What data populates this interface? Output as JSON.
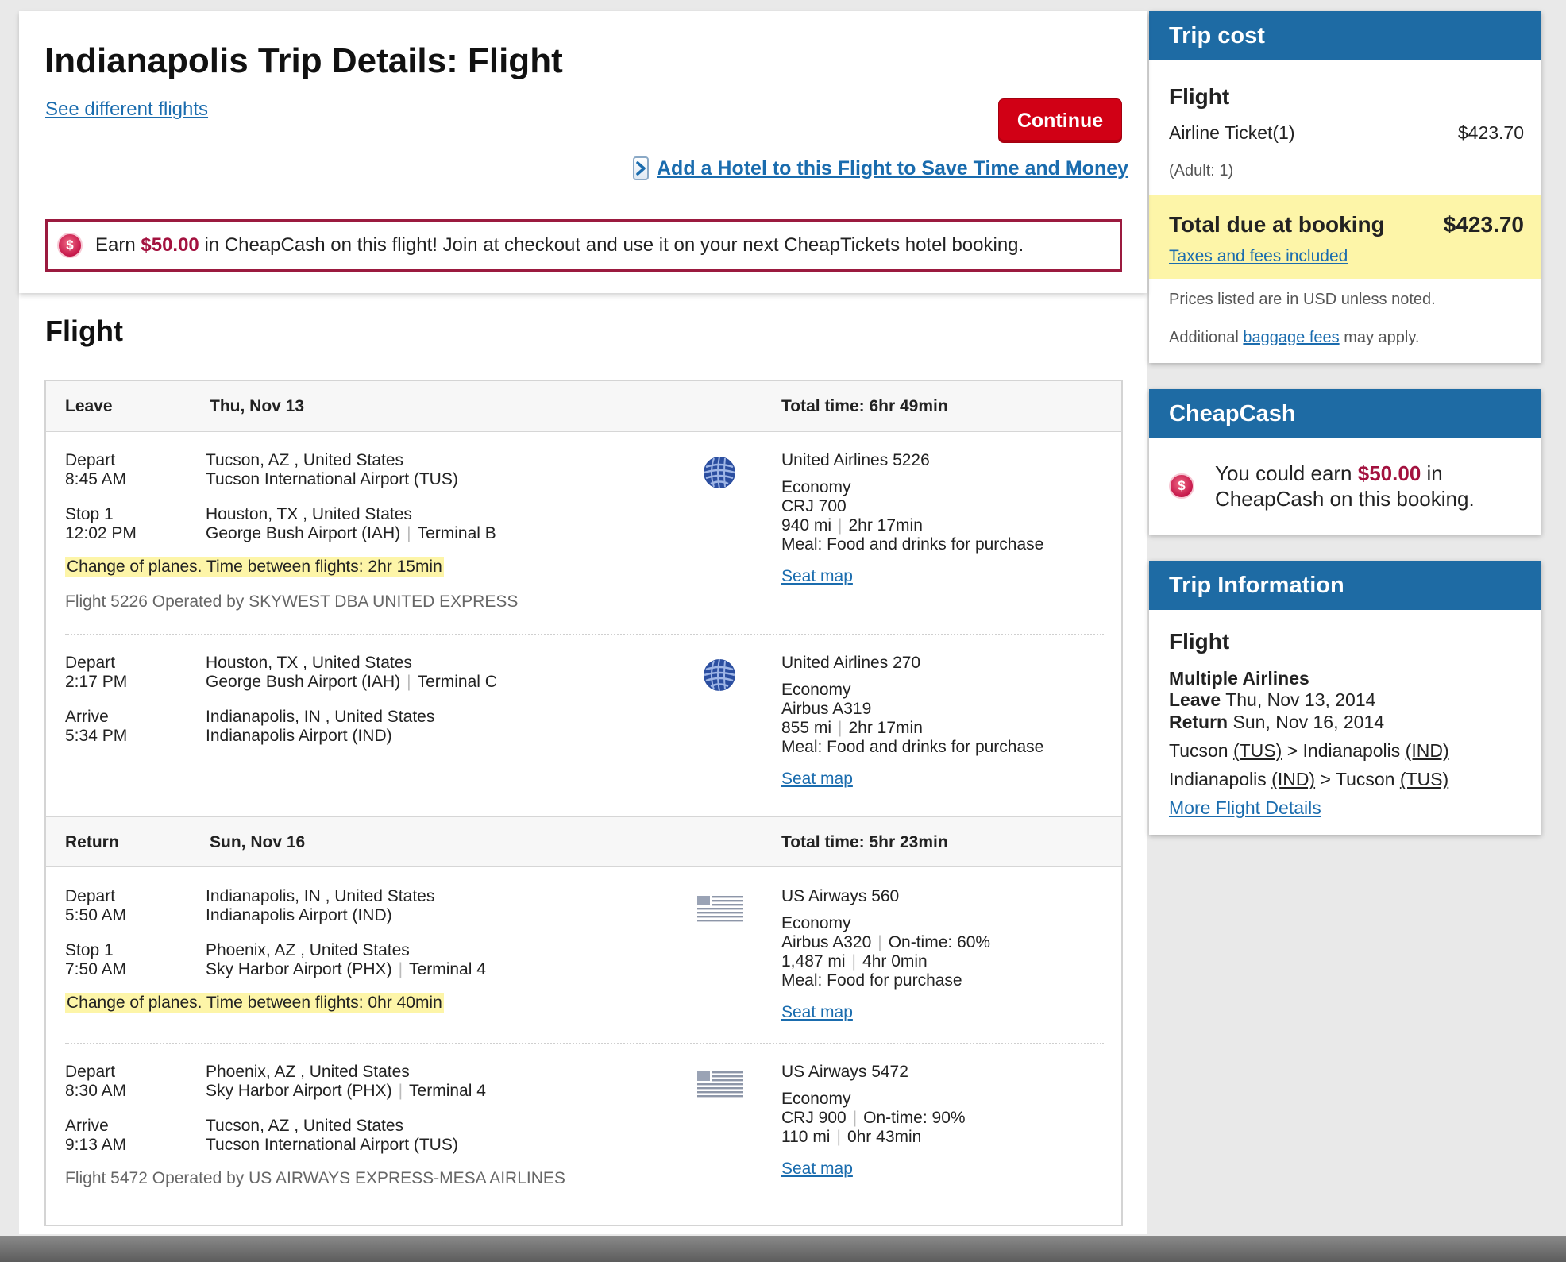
{
  "page": {
    "title": "Indianapolis Trip Details: Flight",
    "see_different_flights": "See different flights",
    "continue_label": "Continue",
    "hotel_link": "Add a Hotel to this Flight to Save Time and Money",
    "banner": {
      "pre": "Earn ",
      "amount": "$50.00",
      "post": " in CheapCash on this flight! Join at checkout and use it on your next CheapTickets hotel booking."
    }
  },
  "flight": {
    "heading": "Flight",
    "legs": [
      {
        "type": "Leave",
        "date": "Thu, Nov 13",
        "total_time": "Total time: 6hr 49min",
        "segments": [
          {
            "from_label": "Depart",
            "from_time": "8:45 AM",
            "from_city": "Tucson, AZ , United States",
            "from_airport": "Tucson International Airport (TUS)",
            "from_terminal": "",
            "to_label": "Stop 1",
            "to_time": "12:02 PM",
            "to_city": "Houston, TX , United States",
            "to_airport": "George Bush Airport (IAH)",
            "to_terminal": "Terminal B",
            "airline_icon": "united-airlines-globe-icon",
            "flight": "United Airlines 5226",
            "cabin": "Economy",
            "aircraft": "CRJ 700",
            "ontime": "",
            "distance": "940 mi",
            "duration": "2hr 17min",
            "meal": "Meal: Food and drinks for purchase",
            "seat_map": "Seat map",
            "change_note": "Change of planes. Time between flights: 2hr 15min",
            "operated_by": "Flight 5226 Operated by SKYWEST DBA UNITED EXPRESS"
          },
          {
            "from_label": "Depart",
            "from_time": "2:17 PM",
            "from_city": "Houston, TX , United States",
            "from_airport": "George Bush Airport (IAH)",
            "from_terminal": "Terminal C",
            "to_label": "Arrive",
            "to_time": "5:34 PM",
            "to_city": "Indianapolis, IN , United States",
            "to_airport": "Indianapolis Airport (IND)",
            "to_terminal": "",
            "airline_icon": "united-airlines-globe-icon",
            "flight": "United Airlines 270",
            "cabin": "Economy",
            "aircraft": "Airbus A319",
            "ontime": "",
            "distance": "855 mi",
            "duration": "2hr 17min",
            "meal": "Meal: Food and drinks for purchase",
            "seat_map": "Seat map"
          }
        ]
      },
      {
        "type": "Return",
        "date": "Sun, Nov 16",
        "total_time": "Total time: 5hr 23min",
        "segments": [
          {
            "from_label": "Depart",
            "from_time": "5:50 AM",
            "from_city": "Indianapolis, IN , United States",
            "from_airport": "Indianapolis Airport (IND)",
            "from_terminal": "",
            "to_label": "Stop 1",
            "to_time": "7:50 AM",
            "to_city": "Phoenix, AZ , United States",
            "to_airport": "Sky Harbor Airport (PHX)",
            "to_terminal": "Terminal 4",
            "airline_icon": "us-airways-flag-icon",
            "flight": "US Airways 560",
            "cabin": "Economy",
            "aircraft": "Airbus A320",
            "ontime": "On-time: 60%",
            "distance": "1,487 mi",
            "duration": "4hr 0min",
            "meal": "Meal: Food for purchase",
            "seat_map": "Seat map",
            "change_note": "Change of planes. Time between flights: 0hr 40min"
          },
          {
            "from_label": "Depart",
            "from_time": "8:30 AM",
            "from_city": "Phoenix, AZ , United States",
            "from_airport": "Sky Harbor Airport (PHX)",
            "from_terminal": "Terminal 4",
            "to_label": "Arrive",
            "to_time": "9:13 AM",
            "to_city": "Tucson, AZ , United States",
            "to_airport": "Tucson International Airport (TUS)",
            "to_terminal": "",
            "airline_icon": "us-airways-flag-icon",
            "flight": "US Airways 5472",
            "cabin": "Economy",
            "aircraft": "CRJ 900",
            "ontime": "On-time: 90%",
            "distance": "110 mi",
            "duration": "0hr 43min",
            "meal": "",
            "seat_map": "Seat map",
            "operated_by": "Flight 5472 Operated by US AIRWAYS EXPRESS-MESA AIRLINES"
          }
        ]
      }
    ]
  },
  "sidebar": {
    "trip_cost": {
      "heading": "Trip cost",
      "flight_label": "Flight",
      "ticket_label": "Airline Ticket(1)",
      "ticket_price": "$423.70",
      "adult": "(Adult: 1)",
      "total_label": "Total due at booking",
      "total_price": "$423.70",
      "taxes_link": "Taxes and fees included",
      "prices_note": "Prices listed are in USD unless noted.",
      "baggage_pre": "Additional ",
      "baggage_link": "baggage fees",
      "baggage_post": " may apply."
    },
    "cheapcash": {
      "heading": "CheapCash",
      "pre": "You could earn ",
      "amount": "$50.00",
      "post": " in CheapCash on this booking."
    },
    "trip_info": {
      "heading": "Trip Information",
      "flight_label": "Flight",
      "airlines": "Multiple Airlines",
      "leave_label": "Leave",
      "leave_date": "Thu, Nov 13, 2014",
      "return_label": "Return",
      "return_date": "Sun, Nov 16, 2014",
      "route1": {
        "from": "Tucson",
        "from_code": "(TUS)",
        "to": "Indianapolis",
        "to_code": "(IND)"
      },
      "route2": {
        "from": "Indianapolis",
        "from_code": "(IND)",
        "to": "Tucson",
        "to_code": "(TUS)"
      },
      "more_link": "More Flight Details"
    }
  },
  "colors": {
    "brand_red": "#d10015",
    "sidebar_blue": "#1e6ba4",
    "link_blue": "#1a6cae",
    "highlight_yellow": "#fdf5a8",
    "cash_red": "#a3123f"
  }
}
